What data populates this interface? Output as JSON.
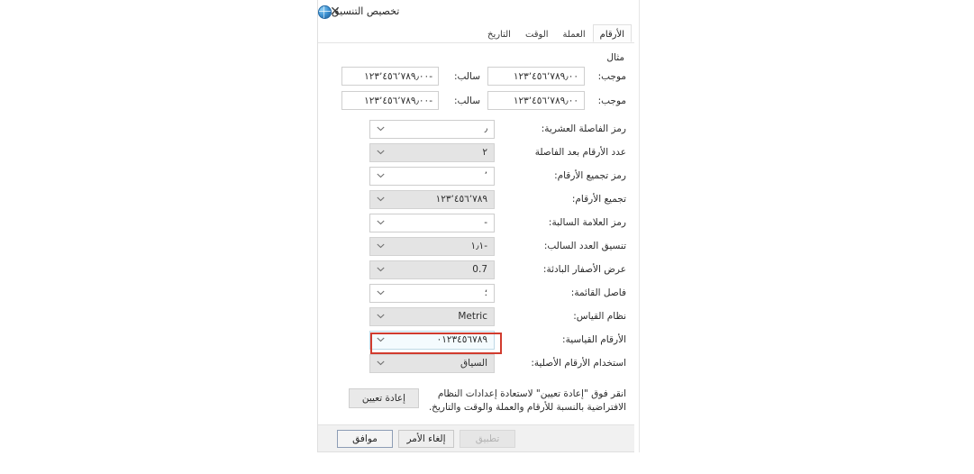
{
  "window": {
    "title": "تخصيص التنسيق",
    "app_icon": "region-globe-icon",
    "close_label": "✕"
  },
  "tabs": [
    {
      "label": "الأرقام",
      "active": true
    },
    {
      "label": "العملة",
      "active": false
    },
    {
      "label": "الوقت",
      "active": false
    },
    {
      "label": "التاريخ",
      "active": false
    }
  ],
  "sample": {
    "group_title": "مثال",
    "positive_label": "موجب:",
    "negative_label": "سالب:",
    "rows": [
      {
        "positive_value": "١٢٣٬٤٥٦٬٧٨٩٫٠٠",
        "negative_value": "١٢٣٬٤٥٦٬٧٨٩٫٠٠-"
      },
      {
        "positive_value": "١٢٣٬٤٥٦٬٧٨٩٫٠٠",
        "negative_value": "١٢٣٬٤٥٦٬٧٨٩٫٠٠-"
      }
    ]
  },
  "settings": {
    "rows": [
      {
        "label": "رمز الفاصلة العشرية:",
        "value": "٫",
        "style": "white",
        "highlighted": false,
        "ltr": false
      },
      {
        "label": "عدد الأرقام بعد الفاصلة",
        "value": "٢",
        "style": "gray",
        "highlighted": false,
        "ltr": false
      },
      {
        "label": "رمز تجميع الأرقام:",
        "value": "٬",
        "style": "white",
        "highlighted": false,
        "ltr": false
      },
      {
        "label": "تجميع الأرقام:",
        "value": "١٢٣٬٤٥٦٬٧٨٩",
        "style": "gray",
        "highlighted": false,
        "ltr": true
      },
      {
        "label": "رمز العلامة السالبة:",
        "value": "-",
        "style": "white",
        "highlighted": false,
        "ltr": false
      },
      {
        "label": "تنسيق العدد السالب:",
        "value": "١٫١-",
        "style": "gray",
        "highlighted": false,
        "ltr": true
      },
      {
        "label": "عرض الأصفار البادئة:",
        "value": "0.7",
        "style": "gray",
        "highlighted": false,
        "ltr": true
      },
      {
        "label": "فاصل القائمة:",
        "value": "؛",
        "style": "white",
        "highlighted": false,
        "ltr": false
      },
      {
        "label": "نظام القياس:",
        "value": "Metric",
        "style": "gray",
        "highlighted": false,
        "ltr": true
      },
      {
        "label": "الأرقام القياسية:",
        "value": "٠١٢٣٤٥٦٧٨٩",
        "style": "white",
        "highlighted": true,
        "ltr": true
      },
      {
        "label": "استخدام الأرقام الأصلية:",
        "value": "السياق",
        "style": "gray",
        "highlighted": false,
        "ltr": false
      }
    ]
  },
  "reset": {
    "description": "انقر فوق \"إعادة تعيين\" لاستعادة إعدادات النظام الافتراضية بالنسبة للأرقام والعملة والوقت والتاريخ.",
    "button_label": "إعادة تعيين"
  },
  "footer": {
    "ok_label": "موافق",
    "cancel_label": "إلغاء الأمر",
    "apply_label": "تطبيق"
  },
  "colors": {
    "highlight_red": "#d13b2e",
    "dialog_bg": "#ffffff",
    "footer_bg": "#f1f1f1",
    "combo_gray": "#e4e4e4"
  }
}
